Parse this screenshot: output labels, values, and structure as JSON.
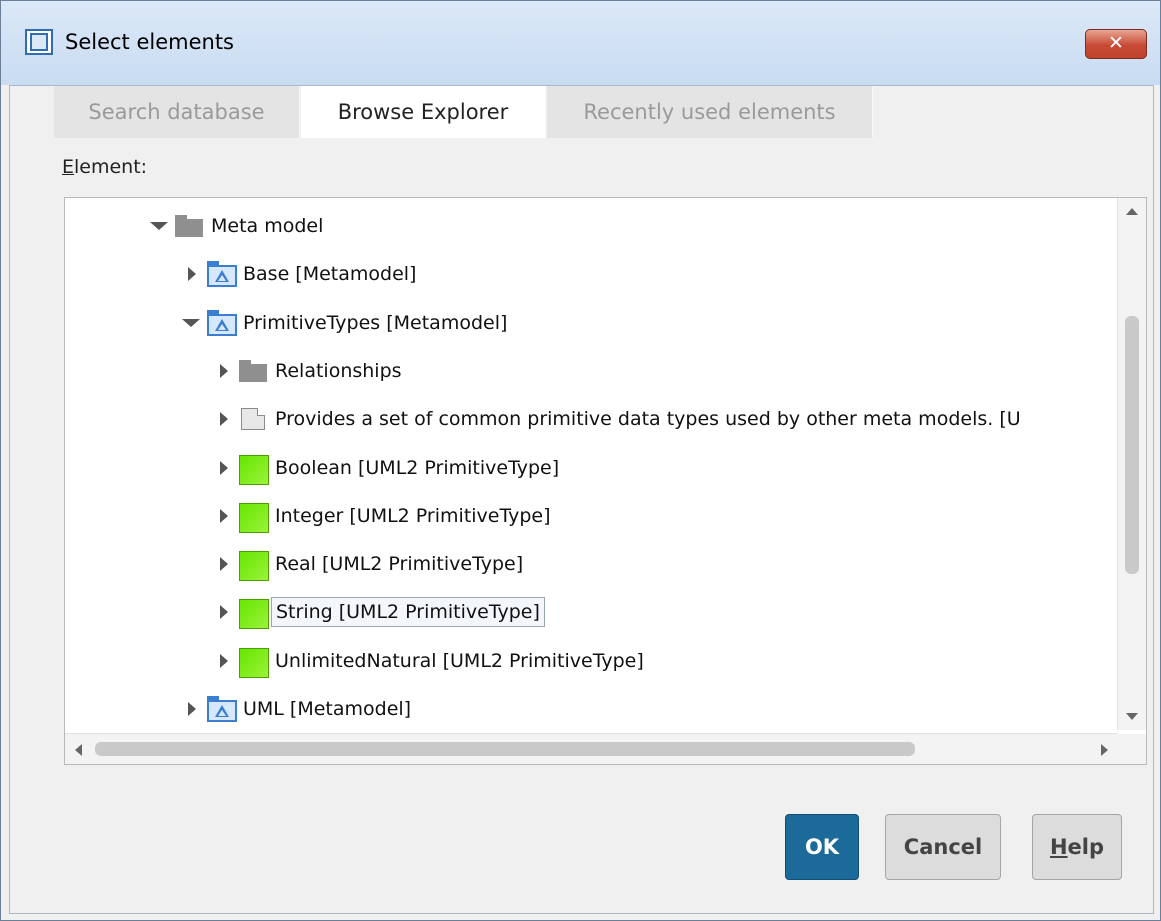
{
  "window": {
    "title": "Select elements",
    "close_label": "✕"
  },
  "tabs": [
    {
      "label": "Search database",
      "active": false
    },
    {
      "label": "Browse Explorer",
      "active": true
    },
    {
      "label": "Recently used elements",
      "active": false
    }
  ],
  "element_label": {
    "accel": "E",
    "rest": "lement:"
  },
  "tree": [
    {
      "label": "Meta model",
      "icon": "folder-gray-icon",
      "expand": "down",
      "level": 0
    },
    {
      "label": "Base [Metamodel]",
      "icon": "metamodel-package-icon",
      "expand": "right",
      "level": 1
    },
    {
      "label": "PrimitiveTypes [Metamodel]",
      "icon": "metamodel-package-icon",
      "expand": "down",
      "level": 1
    },
    {
      "label": "Relationships",
      "icon": "folder-gray-icon",
      "expand": "right",
      "level": 2
    },
    {
      "label": "Provides a set of common primitive data types used by other meta models. [U",
      "icon": "note-icon",
      "expand": "right",
      "level": 2
    },
    {
      "label": "Boolean [UML2 PrimitiveType]",
      "icon": "primitive-type-icon",
      "expand": "right",
      "level": 2
    },
    {
      "label": "Integer [UML2 PrimitiveType]",
      "icon": "primitive-type-icon",
      "expand": "right",
      "level": 2
    },
    {
      "label": "Real [UML2 PrimitiveType]",
      "icon": "primitive-type-icon",
      "expand": "right",
      "level": 2
    },
    {
      "label": "String [UML2 PrimitiveType]",
      "icon": "primitive-type-icon",
      "expand": "right",
      "level": 2,
      "selected": true
    },
    {
      "label": "UnlimitedNatural [UML2 PrimitiveType]",
      "icon": "primitive-type-icon",
      "expand": "right",
      "level": 2
    },
    {
      "label": "UML [Metamodel]",
      "icon": "metamodel-package-icon",
      "expand": "right",
      "level": 1
    }
  ],
  "buttons": {
    "ok": "OK",
    "cancel": "Cancel",
    "help_accel": "H",
    "help_rest": "elp"
  },
  "colors": {
    "ok_button": "#1c6a9a",
    "primitive_icon": "#66e600",
    "metamodel_icon": "#3b7ed0"
  }
}
